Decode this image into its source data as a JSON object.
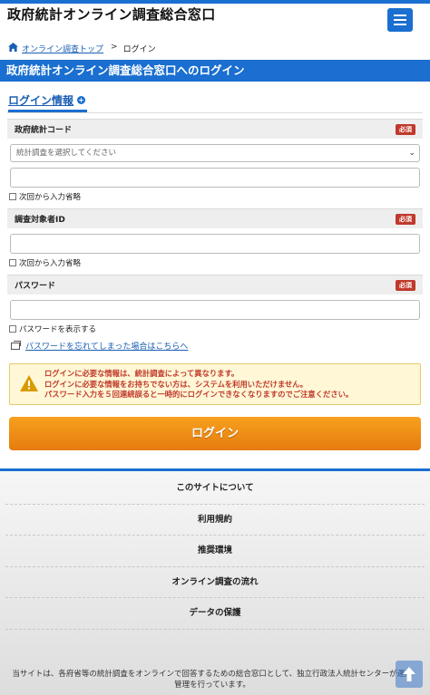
{
  "header": {
    "site_title": "政府統計オンライン調査総合窓口",
    "menu_icon": "hamburger-icon"
  },
  "breadcrumb": {
    "home_label": "オンライン調査トップ",
    "separator": ">",
    "current": "ログイン"
  },
  "page_title": "政府統計オンライン調査総合窓口へのログイン",
  "section": {
    "title": "ログイン情報",
    "expand_icon": "plus-circle-icon"
  },
  "form": {
    "required_badge": "必須",
    "stat_code": {
      "label": "政府統計コード",
      "select_placeholder": "統計調査を選択してください",
      "text_value": "",
      "remember_label": "次回から入力省略"
    },
    "respondent_id": {
      "label": "調査対象者ID",
      "value": "",
      "remember_label": "次回から入力省略"
    },
    "password": {
      "label": "パスワード",
      "value": "",
      "show_label": "パスワードを表示する"
    },
    "forgot_link": "パスワードを忘れてしまった場合はこちらへ"
  },
  "notice": {
    "lines": [
      "ログインに必要な情報は、統計調査によって異なります。",
      "ログインに必要な情報をお持ちでない方は、システムを利用いただけません。",
      "パスワード入力を５回連続誤ると一時的にログインできなくなりますのでご注意ください。"
    ]
  },
  "login_button": "ログイン",
  "footer": {
    "links": [
      "このサイトについて",
      "利用規約",
      "推奨環境",
      "オンライン調査の流れ",
      "データの保護"
    ],
    "description": "当サイトは、各府省等の統計調査をオンラインで回答するための総合窓口として、独立行政法人統計センターが運用管理を行っています。"
  },
  "colors": {
    "brand_blue": "#1a6fd0",
    "login_orange": "#f39218",
    "required_red": "#c0392b"
  }
}
